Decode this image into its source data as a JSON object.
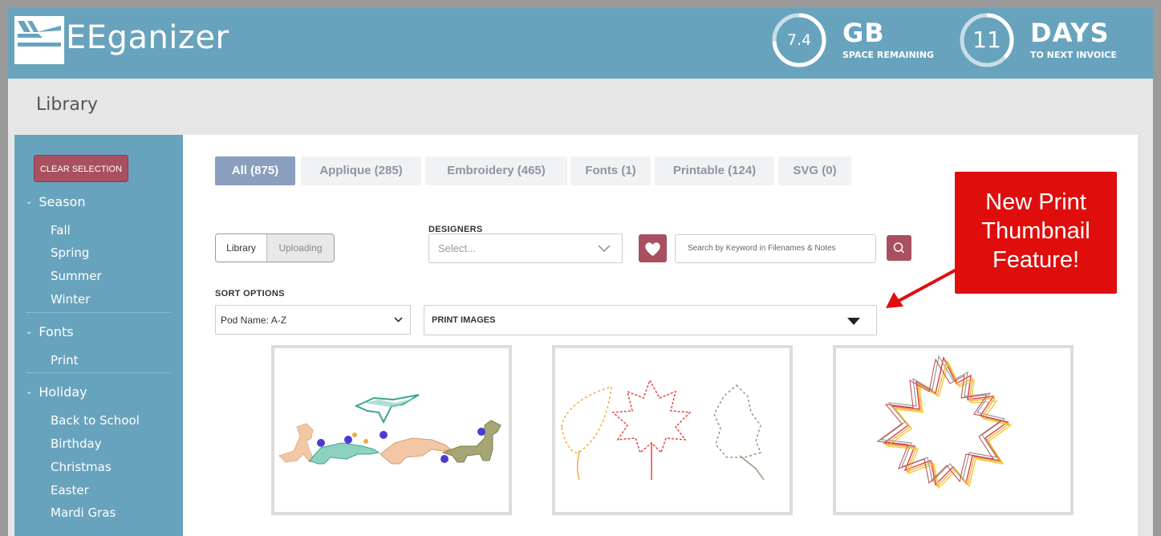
{
  "app": {
    "name": "EEganizer"
  },
  "stats": [
    {
      "value": "7.4",
      "big": "GB",
      "small": "SPACE REMAINING",
      "fraction": 0.74
    },
    {
      "value": "11",
      "big": "DAYS",
      "small": "TO NEXT INVOICE",
      "fraction": 0.37
    }
  ],
  "page": {
    "title": "Library"
  },
  "sidebar": {
    "clear_label": "CLEAR SELECTION",
    "groups": [
      {
        "label": "Season",
        "items": [
          "Fall",
          "Spring",
          "Summer",
          "Winter"
        ]
      },
      {
        "label": "Fonts",
        "items": [
          "Print"
        ]
      },
      {
        "label": "Holiday",
        "items": [
          "Back to School",
          "Birthday",
          "Christmas",
          "Easter",
          "Mardi Gras"
        ]
      }
    ]
  },
  "tabs": [
    "All (875)",
    "Applique (285)",
    "Embroidery (465)",
    "Fonts (1)",
    "Printable (124)",
    "SVG (0)"
  ],
  "filters": {
    "library_label": "Library",
    "uploading_label": "Uploading",
    "designers_label": "DESIGNERS",
    "designers_placeholder": "Select...",
    "search_placeholder": "Search by Keyword in Filenames & Notes",
    "sort_label": "SORT OPTIONS",
    "sort_value": "Pod Name: A-Z",
    "print_images_label": "PRINT IMAGES"
  },
  "callout": {
    "line1": "New Print",
    "line2": "Thumbnail",
    "line3": "Feature!"
  },
  "colors": {
    "topbar": "#68a3bd",
    "accent": "#a8505f",
    "callout": "#e00d0d",
    "active_tab": "#8a9ebd"
  }
}
